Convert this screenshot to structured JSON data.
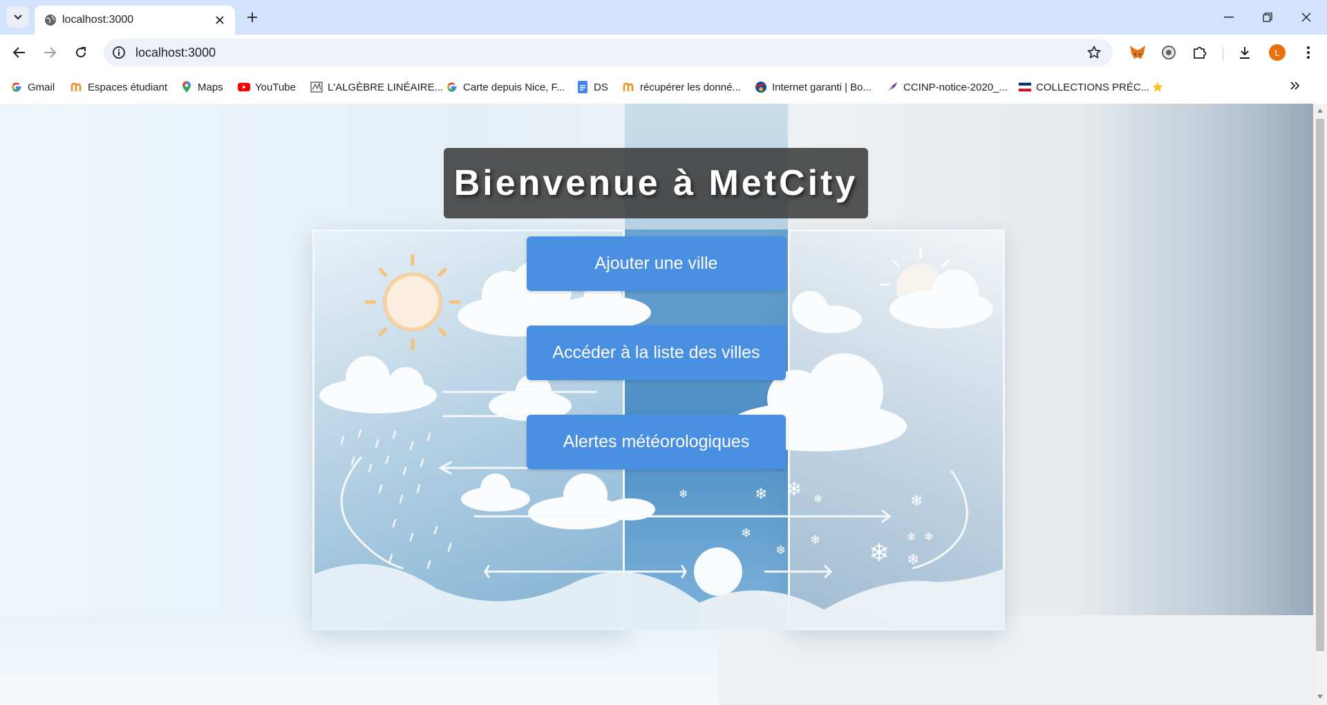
{
  "browser": {
    "tab": {
      "title": "localhost:3000",
      "favicon": "globe-icon"
    },
    "address_bar": {
      "url": "localhost:3000"
    },
    "profile_initial": "L",
    "accent_color": "#e8710a",
    "bookmarks": [
      {
        "label": "Gmail",
        "icon": "google-g-icon"
      },
      {
        "label": "Espaces étudiant",
        "icon": "m-logo-icon"
      },
      {
        "label": "Maps",
        "icon": "maps-pin-icon"
      },
      {
        "label": "YouTube",
        "icon": "youtube-icon"
      },
      {
        "label": "L'ALGÈBRE LINÉAIRE...",
        "icon": "document-thumb-icon"
      },
      {
        "label": "Carte depuis Nice, F...",
        "icon": "google-g-icon"
      },
      {
        "label": "DS",
        "icon": "google-docs-icon"
      },
      {
        "label": "récupérer les donné...",
        "icon": "m-logo-icon"
      },
      {
        "label": "Internet garanti | Bo...",
        "icon": "bouygues-icon"
      },
      {
        "label": "CCINP-notice-2020_...",
        "icon": "quill-icon"
      },
      {
        "label": "COLLECTIONS PRÉC...",
        "icon": "flag-icon"
      }
    ]
  },
  "page": {
    "title": "Bienvenue à MetCity",
    "buttons": [
      {
        "label": "Ajouter une ville"
      },
      {
        "label": "Accéder à la liste des villes"
      },
      {
        "label": "Alertes météorologiques"
      }
    ],
    "button_color": "#4a90e2",
    "title_box_color": "#3c3c3c"
  }
}
